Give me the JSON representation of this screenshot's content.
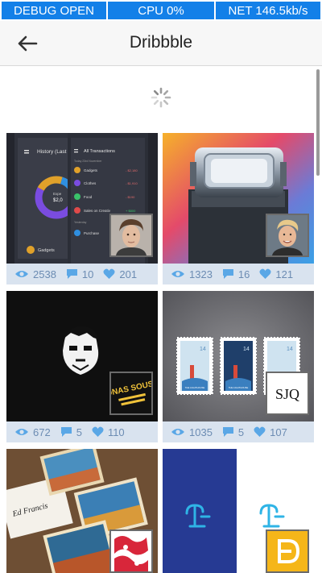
{
  "debug": {
    "open_label": "DEBUG OPEN",
    "cpu_label": "CPU 0%",
    "net_label": "NET 146.5kb/s"
  },
  "header": {
    "title": "Dribbble",
    "back_icon": "arrow-left-icon"
  },
  "colors": {
    "debug_bg": "#1380e8",
    "stats_bar": "#d9e3ef",
    "stats_text": "#6c8cb3"
  },
  "shots": [
    {
      "views": "2538",
      "comments": "10",
      "likes": "201"
    },
    {
      "views": "1323",
      "comments": "16",
      "likes": "121"
    },
    {
      "views": "672",
      "comments": "5",
      "likes": "110"
    },
    {
      "views": "1035",
      "comments": "5",
      "likes": "107"
    }
  ],
  "shot_texts": {
    "history_title": "History (Last",
    "transactions_title": "All Transactions",
    "gadgets_label": "Gadgets",
    "clothes_label": "Clothes",
    "food_label": "Food",
    "sales_label": "Sales on Creativ",
    "today_label": "Today 23rd November",
    "yesterday_label": "Yesterday",
    "purchase_label": "Purchase",
    "amount_1": "- $2,180",
    "amount_2": "- $1,910",
    "amount_3": "- $190",
    "amount_4": "+ $800",
    "donut_expense": "Expe",
    "donut_amount": "$2,0",
    "stamp_number": "14",
    "stamp_name": "THE LIGHTHOUSE",
    "sjq_label": "SJQ",
    "jonas_logo": "JONAS SOUSA",
    "signature_text": "Ed Francis"
  }
}
